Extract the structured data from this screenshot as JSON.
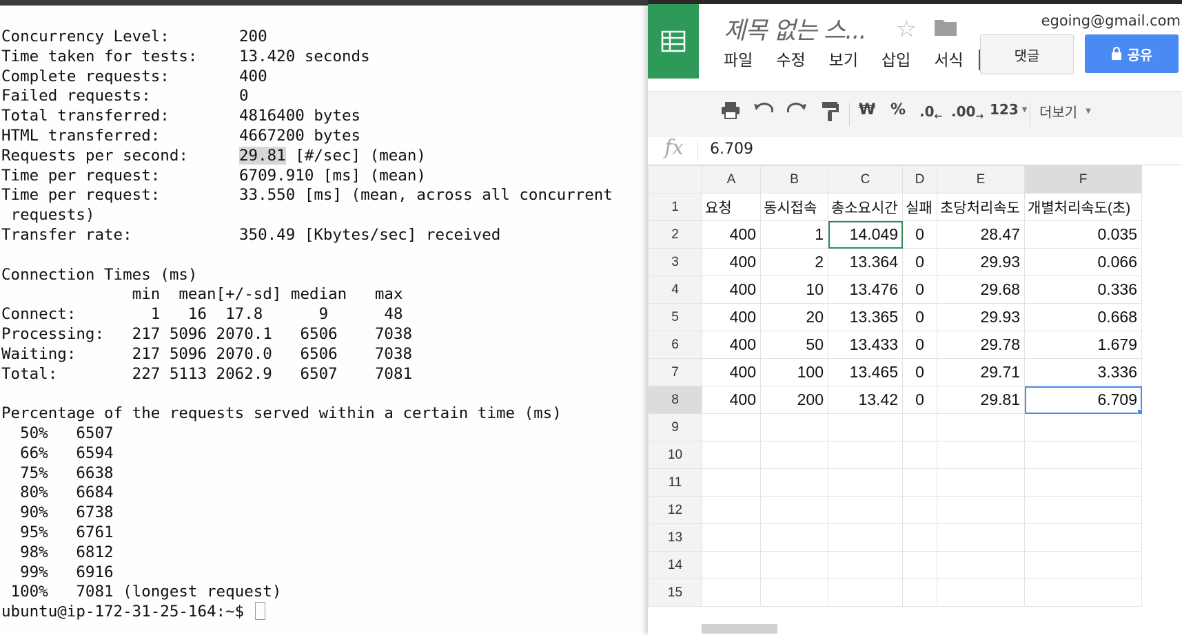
{
  "terminal": {
    "lines": [
      {
        "label": "Concurrency Level:",
        "value": "200"
      },
      {
        "label": "Time taken for tests:",
        "value": "13.420 seconds"
      },
      {
        "label": "Complete requests:",
        "value": "400"
      },
      {
        "label": "Failed requests:",
        "value": "0"
      },
      {
        "label": "Total transferred:",
        "value": "4816400 bytes"
      },
      {
        "label": "HTML transferred:",
        "value": "4667200 bytes"
      },
      {
        "label": "Requests per second:",
        "value_highlight": "29.81",
        "value_rest": " [#/sec] (mean)"
      },
      {
        "label": "Time per request:",
        "value": "6709.910 [ms] (mean)"
      },
      {
        "label": "Time per request:",
        "value": "33.550 [ms] (mean, across all concurrent"
      },
      {
        "text": " requests)"
      },
      {
        "label": "Transfer rate:",
        "value": "350.49 [Kbytes/sec] received"
      },
      {
        "text": ""
      },
      {
        "text": "Connection Times (ms)"
      },
      {
        "text": "              min  mean[+/-sd] median   max"
      },
      {
        "text": "Connect:        1   16  17.8      9      48"
      },
      {
        "text": "Processing:   217 5096 2070.1   6506    7038"
      },
      {
        "text": "Waiting:      217 5096 2070.0   6506    7038"
      },
      {
        "text": "Total:        227 5113 2062.9   6507    7081"
      },
      {
        "text": ""
      },
      {
        "text": "Percentage of the requests served within a certain time (ms)"
      },
      {
        "text": "  50%   6507"
      },
      {
        "text": "  66%   6594"
      },
      {
        "text": "  75%   6638"
      },
      {
        "text": "  80%   6684"
      },
      {
        "text": "  90%   6738"
      },
      {
        "text": "  95%   6761"
      },
      {
        "text": "  98%   6812"
      },
      {
        "text": "  99%   6916"
      },
      {
        "text": " 100%   7081 (longest request)"
      }
    ],
    "prompt": "ubuntu@ip-172-31-25-164:~$ "
  },
  "sheet": {
    "title": "제목 없는 스...",
    "account": "egoing@gmail.com",
    "menu": [
      "파일",
      "수정",
      "보기",
      "삽입",
      "서식"
    ],
    "comment_label": "댓글",
    "share_label": "공유",
    "toolbar": {
      "currency": "₩",
      "percent": "%",
      "dec_decrease": ".0",
      "dec_increase": ".00",
      "format_more": "123",
      "more_label": "더보기"
    },
    "formula_value": "6.709",
    "columns": [
      "A",
      "B",
      "C",
      "D",
      "E",
      "F"
    ],
    "row_numbers": [
      "1",
      "2",
      "3",
      "4",
      "5",
      "6",
      "7",
      "8",
      "9",
      "10",
      "11",
      "12",
      "13",
      "14",
      "15"
    ],
    "header_row": [
      "요청",
      "동시접속",
      "총소요시간",
      "실패",
      "초당처리속도",
      "개별처리속도(초)"
    ],
    "rows": [
      [
        "400",
        "1",
        "14.049",
        "0",
        "28.47",
        "0.035"
      ],
      [
        "400",
        "2",
        "13.364",
        "0",
        "29.93",
        "0.066"
      ],
      [
        "400",
        "10",
        "13.476",
        "0",
        "29.68",
        "0.336"
      ],
      [
        "400",
        "20",
        "13.365",
        "0",
        "29.93",
        "0.668"
      ],
      [
        "400",
        "50",
        "13.433",
        "0",
        "29.78",
        "1.679"
      ],
      [
        "400",
        "100",
        "13.465",
        "0",
        "29.71",
        "3.336"
      ],
      [
        "400",
        "200",
        "13.42",
        "0",
        "29.81",
        "6.709"
      ]
    ],
    "colors": {
      "brand": "#2d9a5a",
      "share": "#4a8af4",
      "selection": "#2e8b57"
    }
  }
}
